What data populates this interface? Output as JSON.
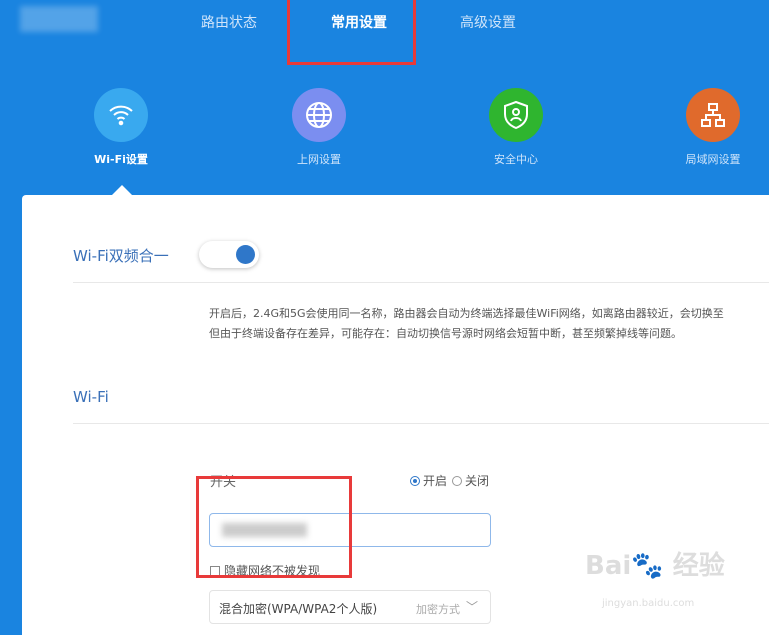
{
  "nav": {
    "tabs": [
      {
        "label": "路由状态",
        "active": false
      },
      {
        "label": "常用设置",
        "active": true
      },
      {
        "label": "高级设置",
        "active": false
      }
    ]
  },
  "categories": [
    {
      "label": "Wi-Fi设置",
      "icon": "wifi-icon",
      "color": "#39a9ef",
      "active": true
    },
    {
      "label": "上网设置",
      "icon": "globe-icon",
      "color": "#7b8ef0"
    },
    {
      "label": "安全中心",
      "icon": "shield-icon",
      "color": "#2fb52f"
    },
    {
      "label": "局域网设置",
      "icon": "network-icon",
      "color": "#e06a2c"
    }
  ],
  "dualband": {
    "title": "Wi-Fi双频合一",
    "enabled": true,
    "desc1": "开启后，2.4G和5G会使用同一名称，路由器会自动为终端选择最佳WiFi网络，如离路由器较近，会切换至",
    "desc2": "但由于终端设备存在差异，可能存在：自动切换信号源时网络会短暂中断，甚至频繁掉线等问题。"
  },
  "wifi": {
    "title": "Wi-Fi",
    "switch_label": "开关",
    "on_label": "开启",
    "off_label": "关闭",
    "selected": "开启",
    "hide_label": "隐藏网络不被发现",
    "hidden": false,
    "encryption": "混合加密(WPA/WPA2个人版)",
    "encryption_hint": "加密方式"
  },
  "watermark": {
    "brand": "Bai du 经验",
    "url": "jingyan.baidu.com"
  },
  "colors": {
    "header": "#1a84e0",
    "highlight": "#e83a3a"
  }
}
